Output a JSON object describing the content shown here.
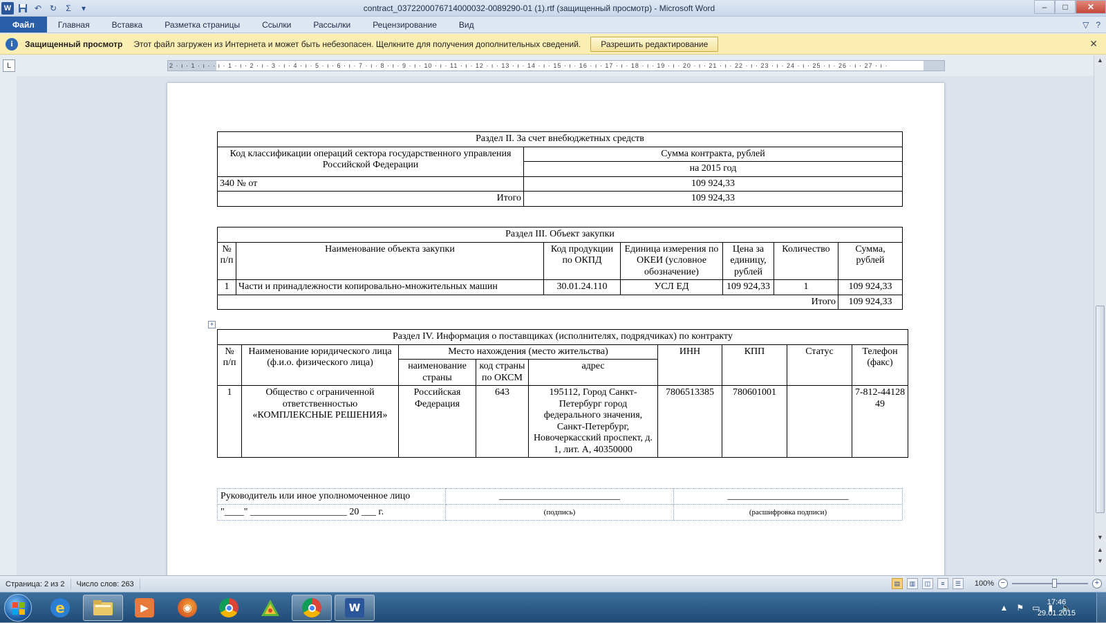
{
  "window": {
    "title": "contract_0372200076714000032-0089290-01 (1).rtf (защищенный просмотр)  -  Microsoft Word",
    "app_icon_letter": "W",
    "minimize": "–",
    "maximize": "□",
    "close": "✕"
  },
  "qat": {
    "save": "💾",
    "undo": "↶",
    "redo": "↻",
    "sigma": "Σ",
    "customize": "▾"
  },
  "ribbon": {
    "tabs": [
      "Файл",
      "Главная",
      "Вставка",
      "Разметка страницы",
      "Ссылки",
      "Рассылки",
      "Рецензирование",
      "Вид"
    ],
    "right_icons": [
      "▽",
      "?"
    ]
  },
  "protected_view": {
    "title": "Защищенный просмотр",
    "message": "Этот файл загружен из Интернета и может быть небезопасен. Щелкните для получения дополнительных сведений.",
    "button": "Разрешить редактирование",
    "close": "✕"
  },
  "ruler": {
    "tab_selector": "L",
    "numbers": "2 · ı · 1 · ı ·   · ı · 1 · ı · 2 · ı · 3 · ı · 4 · ı · 5 · ı · 6 · ı · 7 · ı · 8 · ı · 9 · ı · 10 · ı · 11 · ı · 12 · ı · 13 · ı · 14 · ı · 15 · ı · 16 · ı · 17 · ı · 18 · ı · 19 · ı · 20 · ı · 21 · ı · 22 · ı · 23 · ı · 24 · ı · 25 · ı · 26 · ı · 27 · ı ·"
  },
  "section2": {
    "title": "Раздел II. За счет внебюджетных средств",
    "col_code": "Код классификации операций сектора государственного управления Российской Федерации",
    "col_sum": "Сумма контракта, рублей",
    "col_year": "на 2015 год",
    "row_code": "340   №   от",
    "row_sum": "109 924,33",
    "total_label": "Итого",
    "total_sum": "109 924,33"
  },
  "section3": {
    "title": "Раздел III. Объект закупки",
    "headers": [
      "№ п/п",
      "Наименование объекта закупки",
      "Код продукции по ОКПД",
      "Единица измерения по ОКЕИ (условное обозначение)",
      "Цена за единицу, рублей",
      "Количество",
      "Сумма, рублей"
    ],
    "row": [
      "1",
      "Части и принадлежности копировально-множительных машин",
      "30.01.24.110",
      "УСЛ ЕД",
      "109 924,33",
      "1",
      "109 924,33"
    ],
    "total_label": "Итого",
    "total_sum": "109 924,33"
  },
  "section4": {
    "title": "Раздел IV. Информация о поставщиках (исполнителях, подрядчиках) по контракту",
    "h_num": "№ п/п",
    "h_name": "Наименование юридического лица (ф.и.о. физического лица)",
    "h_location": "Место нахождения (место жительства)",
    "h_country": "наименование страны",
    "h_oksm": "код страны по ОКСМ",
    "h_address": "адрес",
    "h_inn": "ИНН",
    "h_kpp": "КПП",
    "h_status": "Статус",
    "h_phone": "Телефон (факс)",
    "row": {
      "num": "1",
      "name": "Общество с ограниченной ответственностью «КОМПЛЕКСНЫЕ РЕШЕНИЯ»",
      "country": "Российская Федерация",
      "oksm": "643",
      "address": "195112, Город Санкт-Петербург город федерального значения, Санкт-Петербург, Новочеркасский проспект, д. 1, лит. А, 40350000",
      "inn": "7806513385",
      "kpp": "780601001",
      "status": "",
      "phone": "7-812-4412849"
    }
  },
  "signature": {
    "role": "Руководитель или иное уполномоченное лицо",
    "line1": "_________________________",
    "line2": "_________________________",
    "date": "\"____\" ____________________ 20 ___ г.",
    "caption1": "(подпись)",
    "caption2": "(расшифровка подписи)"
  },
  "statusbar": {
    "page": "Страница: 2 из 2",
    "words": "Число слов: 263",
    "zoom": "100%"
  },
  "taskbar": {
    "clock_time": "17:46",
    "clock_date": "29.01.2015",
    "apps": [
      "internet-explorer",
      "explorer",
      "media-player",
      "firefox",
      "chrome",
      "app-green",
      "chrome",
      "word"
    ]
  },
  "colors": {
    "file_tab": "#2a5ea8",
    "protected_bar": "#fbeeb2",
    "taskbar": "#1f4a75"
  }
}
